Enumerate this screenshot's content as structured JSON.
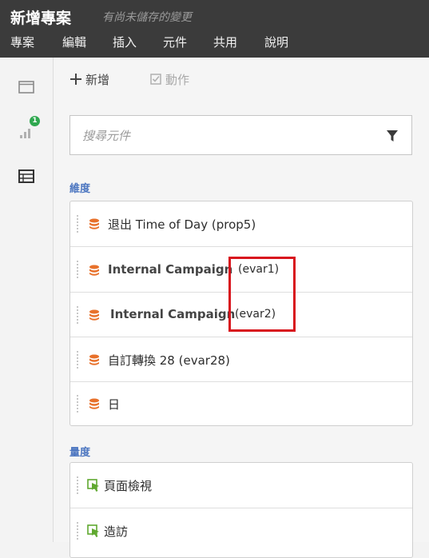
{
  "header": {
    "title": "新增專案",
    "unsaved_note": "有尚未儲存的變更",
    "menu": [
      "專案",
      "編輯",
      "插入",
      "元件",
      "共用",
      "說明"
    ]
  },
  "rail": {
    "items": [
      {
        "icon": "panel-icon"
      },
      {
        "icon": "signal-bars-icon",
        "badge": "1"
      },
      {
        "icon": "components-list-icon"
      }
    ]
  },
  "toolbar": {
    "new_label": "新增",
    "action_label": "動作"
  },
  "search": {
    "placeholder": "搜尋元件"
  },
  "dimensions": {
    "label": "維度",
    "items": [
      {
        "name": "退出 Time of Day ",
        "id": "(prop5)"
      },
      {
        "name": "Internal Campaign",
        "id": "(evar1)"
      },
      {
        "name": "Internal Campaign",
        "id": "(evar2)"
      },
      {
        "name": "自訂轉換 28 ",
        "id": "(evar28)"
      },
      {
        "name": "日",
        "id": ""
      }
    ]
  },
  "metrics": {
    "label": "量度",
    "items": [
      {
        "name": "頁面檢視"
      },
      {
        "name": "造訪"
      }
    ]
  },
  "colors": {
    "header_bg": "#3b3b3b",
    "dimension_icon": "#e8712b",
    "metric_icon": "#5fa82f",
    "section_label": "#4b75c0",
    "highlight": "#d8141d",
    "badge": "#2fa84f"
  }
}
